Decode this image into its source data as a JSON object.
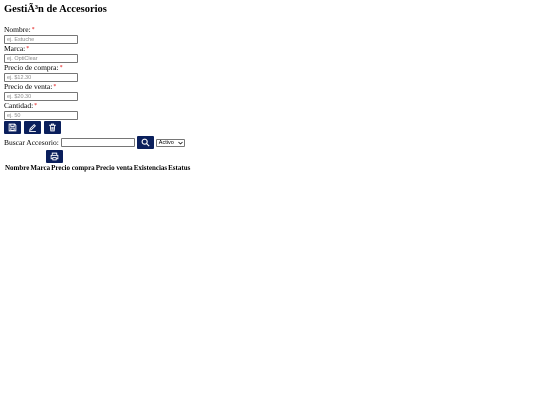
{
  "page": {
    "title": "GestiÃ³n de Accesorios"
  },
  "form": {
    "required_mark": "*",
    "fields": [
      {
        "label": "Nombre:",
        "placeholder": "ej. Estuche"
      },
      {
        "label": "Marca:",
        "placeholder": "ej. OptiClear"
      },
      {
        "label": "Precio de compra:",
        "placeholder": "ej. $12.30"
      },
      {
        "label": "Precio de venta:",
        "placeholder": "ej. $20.30"
      },
      {
        "label": "Cantidad:",
        "placeholder": "ej. 50"
      }
    ]
  },
  "actions": {
    "save_icon": "save-icon",
    "edit_icon": "edit-icon",
    "delete_icon": "trash-icon"
  },
  "search": {
    "label": "Buscar Accesorio:",
    "value": "",
    "button_icon": "search-icon",
    "status_selected": "Activo"
  },
  "print": {
    "icon": "print-icon"
  },
  "table": {
    "headers": [
      "Nombre",
      "Marca",
      "Precio compra",
      "Precio venta",
      "Existencias",
      "Estatus"
    ]
  },
  "colors": {
    "button_bg": "#0a1f5c",
    "required": "#e01010"
  }
}
